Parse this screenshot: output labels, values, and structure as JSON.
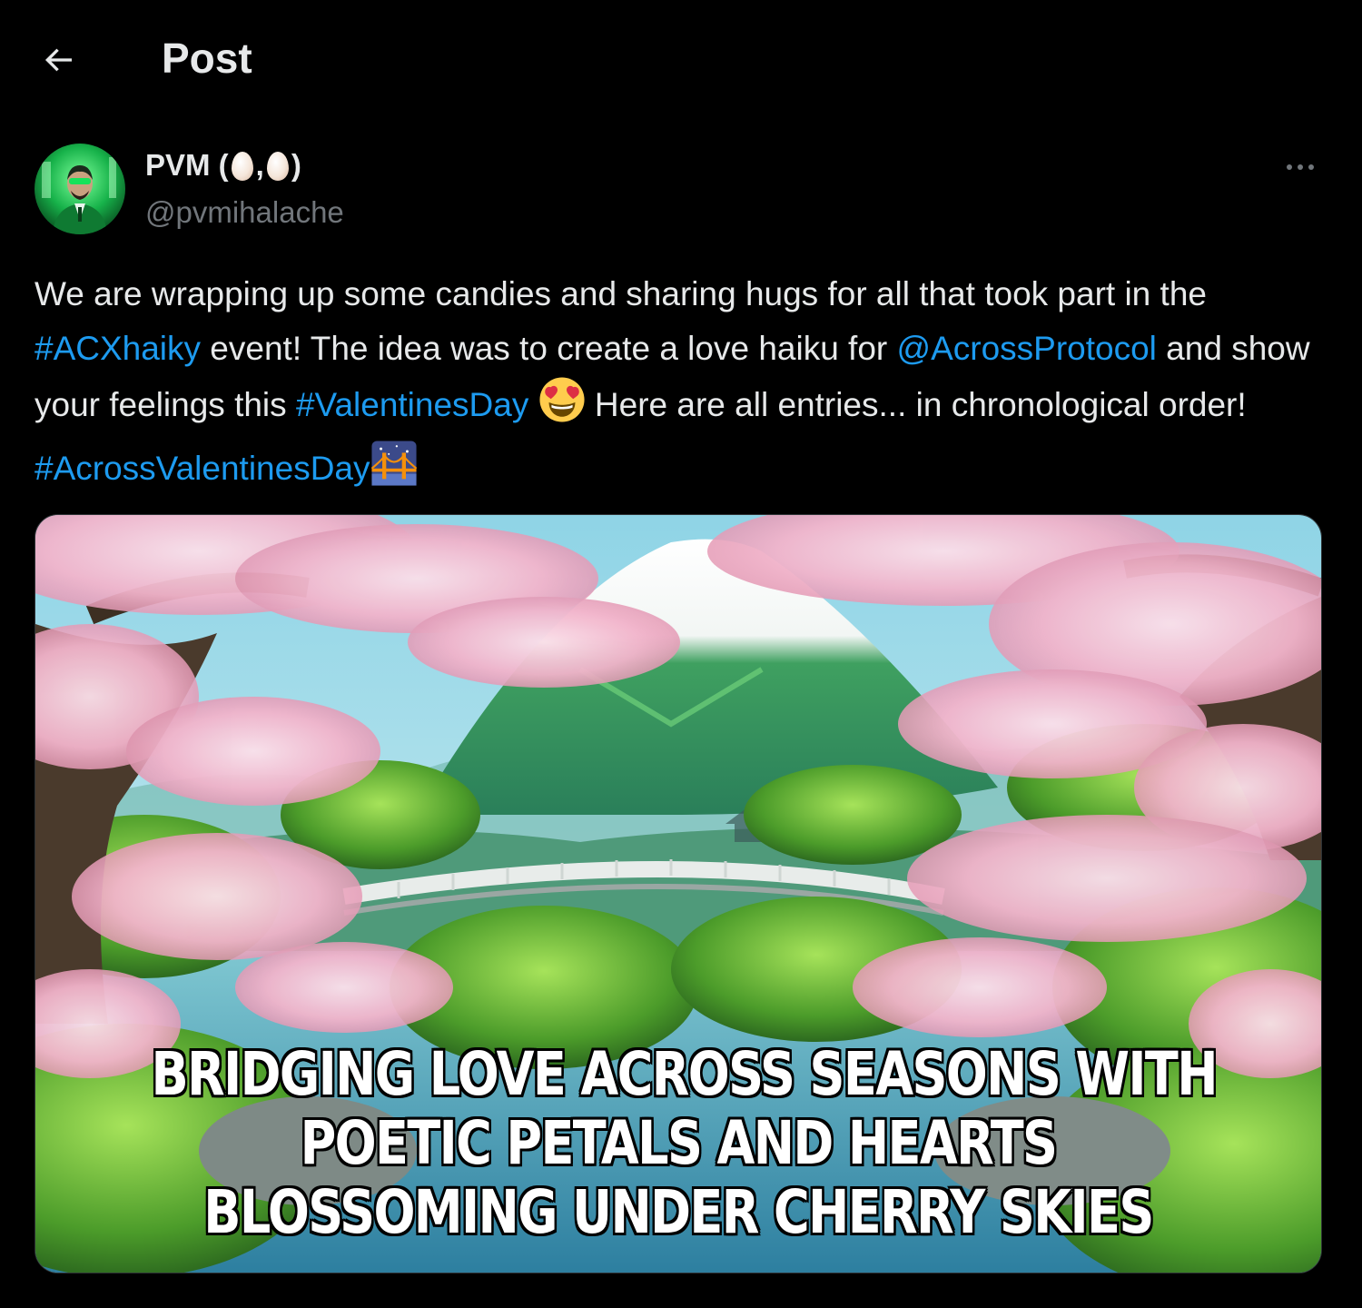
{
  "header": {
    "title": "Post",
    "back_icon": "arrow-left-icon"
  },
  "author": {
    "name_prefix": "PVM (",
    "name_sep": ",",
    "name_suffix": ")",
    "handle": "@pvmihalache",
    "avatar_icon": "avatar-image",
    "more_icon": "more-options-icon"
  },
  "post": {
    "t1": "We are wrapping up some candies and sharing hugs for all that took part in the ",
    "hashtag1": "#ACXhaiky",
    "t2": " event! The idea was to create a love haiku for ",
    "mention1": "@AcrossProtocol",
    "t3": " and show your feelings this ",
    "hashtag2": "#ValentinesDay",
    "t4": " Here are all entries... in chronological order! ",
    "hashtag3": "#AcrossValentinesDay",
    "emoji1": "heart-eyes-emoji",
    "emoji2": "bridge-at-night-emoji"
  },
  "media": {
    "caption_line1": "BRIDGING LOVE ACROSS SEASONS WITH",
    "caption_line2": "POETIC PETALS AND HEARTS",
    "caption_line3": "BLOSSOMING UNDER CHERRY SKIES"
  },
  "colors": {
    "background": "#000000",
    "text": "#e7e9ea",
    "muted": "#71767b",
    "link": "#1d9bf0"
  }
}
